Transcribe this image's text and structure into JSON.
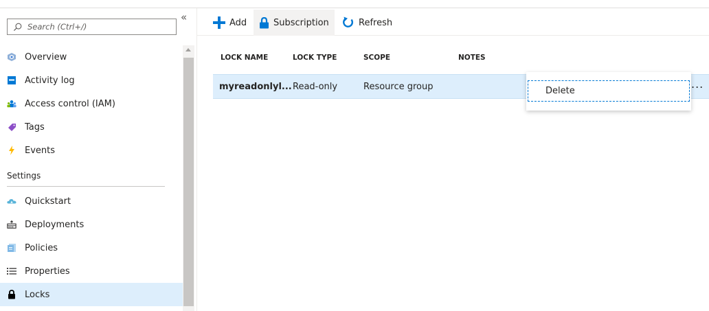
{
  "sidebar": {
    "search_placeholder": "Search (Ctrl+/)",
    "collapse_glyph": "«",
    "items": [
      {
        "label": "Overview",
        "icon": "overview-icon"
      },
      {
        "label": "Activity log",
        "icon": "activity-log-icon"
      },
      {
        "label": "Access control (IAM)",
        "icon": "iam-icon"
      },
      {
        "label": "Tags",
        "icon": "tag-icon"
      },
      {
        "label": "Events",
        "icon": "lightning-icon"
      }
    ],
    "settings_header": "Settings",
    "settings_items": [
      {
        "label": "Quickstart",
        "icon": "cloud-icon"
      },
      {
        "label": "Deployments",
        "icon": "deployments-icon"
      },
      {
        "label": "Policies",
        "icon": "policy-document-icon"
      },
      {
        "label": "Properties",
        "icon": "list-icon"
      },
      {
        "label": "Locks",
        "icon": "lock-icon",
        "selected": true
      }
    ]
  },
  "toolbar": {
    "add_label": "Add",
    "subscription_label": "Subscription",
    "refresh_label": "Refresh"
  },
  "table": {
    "columns": [
      "LOCK NAME",
      "LOCK TYPE",
      "SCOPE",
      "NOTES"
    ],
    "rows": [
      {
        "lock_name": "myreadonlyl...",
        "lock_type": "Read-only",
        "scope": "Resource group",
        "notes": ""
      }
    ],
    "more_glyph": "..."
  },
  "context_menu": {
    "items": [
      "Delete"
    ]
  },
  "colors": {
    "accent": "#0078d4",
    "selected_bg": "#ddeefc"
  }
}
